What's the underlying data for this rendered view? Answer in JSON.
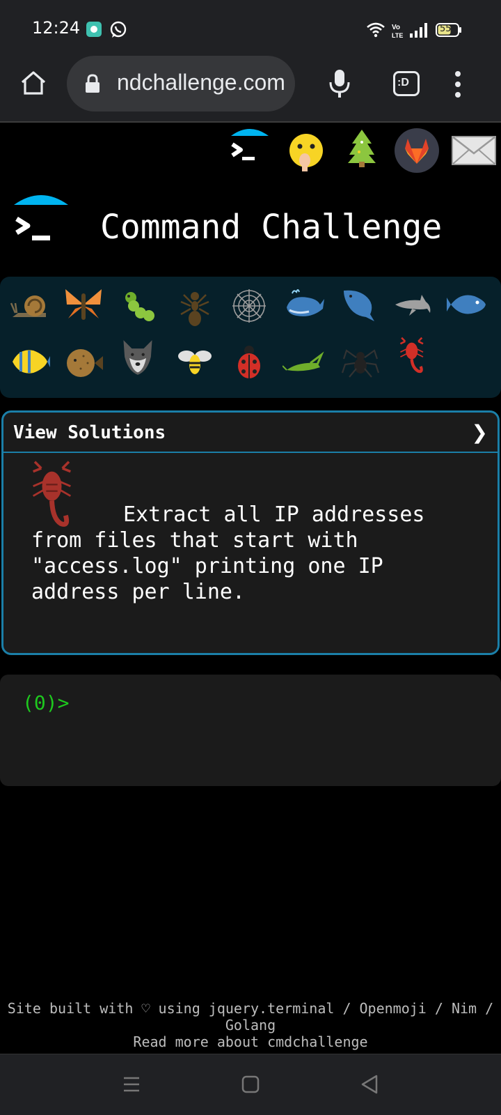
{
  "status_bar": {
    "time": "12:24",
    "battery": "55",
    "icons": [
      "app-notification-icon",
      "whatsapp-icon",
      "wifi-icon",
      "volte-icon",
      "signal-icon",
      "battery-icon"
    ]
  },
  "browser": {
    "url": "ndchallenge.com",
    "icons": [
      "home-icon",
      "lock-icon",
      "mic-icon",
      "tab-switcher-icon",
      "more-menu-icon"
    ],
    "tab_label": ":D"
  },
  "header_icons": [
    "terminal-logo-icon",
    "shush-face-icon",
    "tree-icon",
    "gitlab-icon",
    "mail-icon"
  ],
  "page": {
    "title": "Command Challenge",
    "solutions_label": "View Solutions",
    "solutions_chevron": "❯",
    "challenge_text": "Extract all IP addresses from files that start with \"access.log\" printing one IP address per line.",
    "prompt": "(0)>"
  },
  "animals": {
    "row1": [
      "snail-icon",
      "butterfly-icon",
      "caterpillar-icon",
      "ant-icon",
      "spiderweb-icon",
      "whale-icon",
      "whale2-icon",
      "dolphin-icon",
      "fish-icon"
    ],
    "row2": [
      "tropical-fish-icon",
      "blowfish-icon",
      "wolf-icon",
      "bee-icon",
      "ladybug-icon",
      "cricket-icon",
      "spider-icon",
      "scorpion-icon"
    ]
  },
  "footer": {
    "line1": "Site built with ♡ using jquery.terminal / Openmoji / Nim / Golang",
    "link": "Read more about cmdchallenge"
  },
  "colors": {
    "accent": "#1b7fa8",
    "terminal_green": "#1ec81e",
    "logo_blue": "#00b4f0",
    "panel_bg": "#06202a"
  }
}
